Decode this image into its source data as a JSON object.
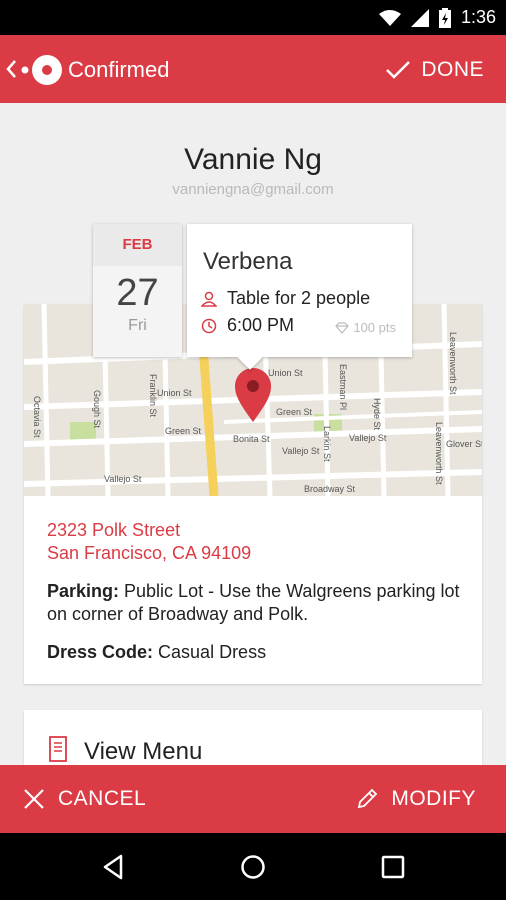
{
  "status_bar": {
    "time": "1:36",
    "icons": [
      "wifi-icon",
      "signal-icon",
      "battery-charging-icon"
    ]
  },
  "app_bar": {
    "title": "Confirmed",
    "done_label": "DONE"
  },
  "guest": {
    "name": "Vannie Ng",
    "email": "vanniengna@gmail.com"
  },
  "reservation": {
    "month": "FEB",
    "day": "27",
    "weekday": "Fri",
    "restaurant": "Verbena",
    "party": "Table for 2 people",
    "time": "6:00 PM",
    "points": "100 pts"
  },
  "map": {
    "streets": [
      "Union St",
      "Union St",
      "Green St",
      "Green St",
      "Bonita St",
      "Vallejo St",
      "Vallejo St",
      "Vallejo St",
      "Broadway St",
      "Octavia St",
      "Gough St",
      "Franklin St",
      "Eastman Pl",
      "Larkin St",
      "Hyde St",
      "Leavenworth St",
      "Leavenworth St",
      "Glover St"
    ]
  },
  "details": {
    "address_line1": "2323 Polk Street",
    "address_line2": "San Francisco, CA 94109",
    "parking_label": "Parking:",
    "parking_value": " Public Lot - Use the Walgreens parking lot on corner of Broadway and Polk.",
    "dress_label": "Dress Code:",
    "dress_value": " Casual Dress"
  },
  "menu": {
    "label": "View Menu"
  },
  "actions": {
    "cancel_label": "CANCEL",
    "modify_label": "MODIFY"
  },
  "colors": {
    "brand": "#db3b45",
    "map_bg": "#e9e5dc",
    "road": "#ffffff",
    "highway": "#f5d15c",
    "park": "#c8df9f"
  }
}
